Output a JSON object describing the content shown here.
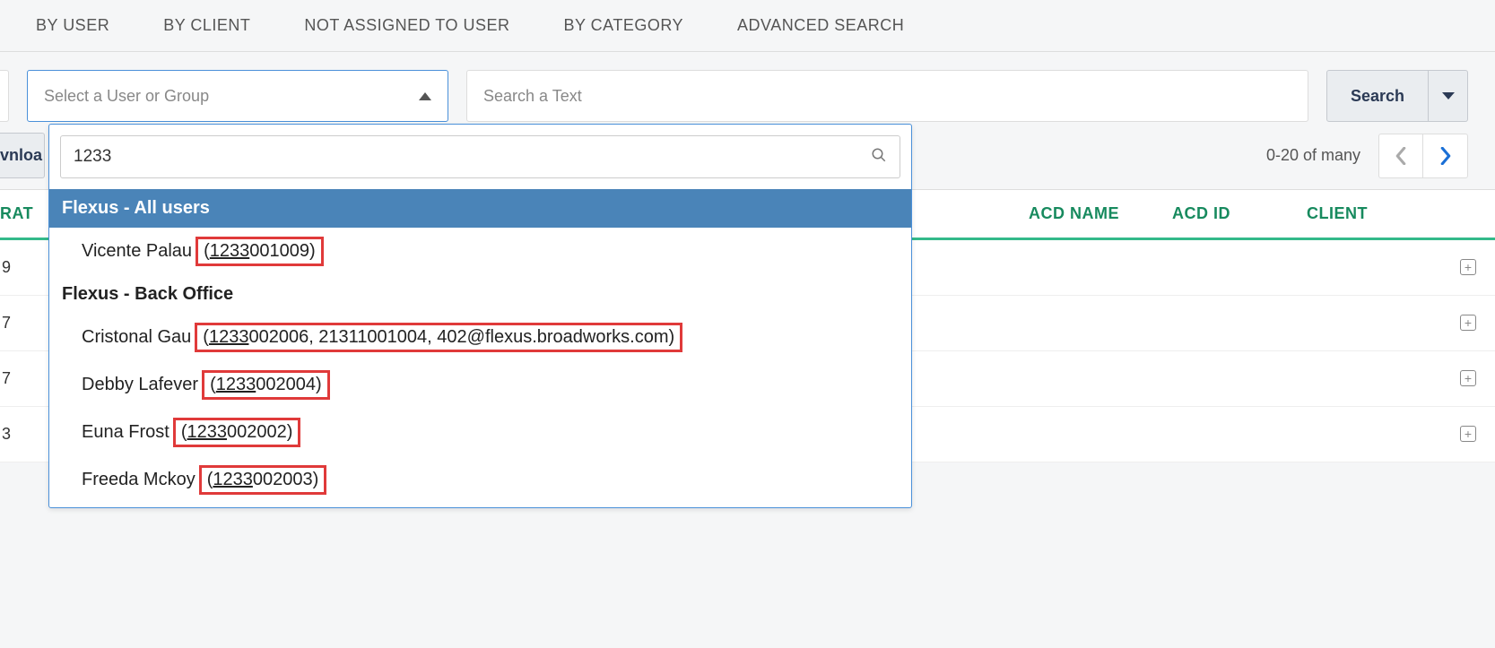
{
  "tabs": [
    "BY USER",
    "BY CLIENT",
    "NOT ASSIGNED TO USER",
    "BY CATEGORY",
    "ADVANCED SEARCH"
  ],
  "select_placeholder": "Select a User or Group",
  "text_search_placeholder": "Search a Text",
  "search_button": "Search",
  "download_stub": "vnloa",
  "pager_text": "0-20 of many",
  "table_headers": {
    "rat": "RAT",
    "acd_name": "ACD NAME",
    "acd_id": "ACD ID",
    "client": "CLIENT"
  },
  "rows": [
    "9",
    "7",
    "7",
    "3"
  ],
  "dropdown": {
    "search_value": "1233",
    "groups": [
      {
        "header": "Flexus - All users",
        "selected": true,
        "items": [
          {
            "name": "Vicente Palau",
            "detail_prefix": "(",
            "match": "1233",
            "detail_rest": "001009)"
          }
        ]
      },
      {
        "header": "Flexus - Back Office",
        "selected": false,
        "items": [
          {
            "name": "Cristonal Gau",
            "detail_prefix": "(",
            "match": "1233",
            "detail_rest": "002006, 21311001004, 402@flexus.broadworks.com)"
          },
          {
            "name": "Debby Lafever",
            "detail_prefix": "(",
            "match": "1233",
            "detail_rest": "002004)"
          },
          {
            "name": "Euna Frost",
            "detail_prefix": "(",
            "match": "1233",
            "detail_rest": "002002)"
          },
          {
            "name": "Freeda Mckoy",
            "detail_prefix": "(",
            "match": "1233",
            "detail_rest": "002003)"
          }
        ]
      }
    ]
  }
}
